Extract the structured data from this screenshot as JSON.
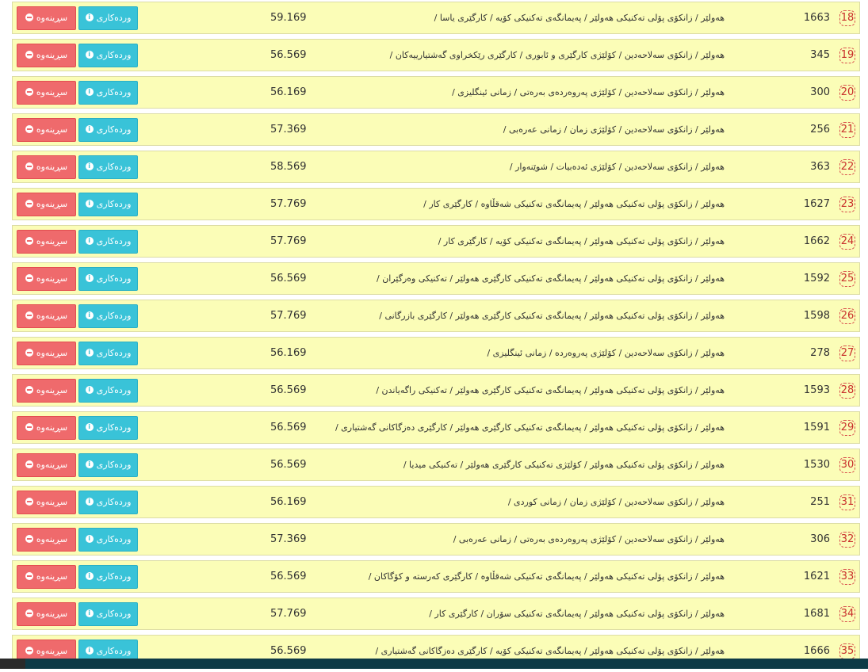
{
  "buttons": {
    "delete_label": "سڕینەوە",
    "info_label": "وردەکاری"
  },
  "rows": [
    {
      "rank": "18",
      "code": "1663",
      "path": "هەولێر / زانکۆی پۆلی تەکنیکی هەولێر / پەیمانگەی تەکنیکی کۆیە / کارگێری یاسا /",
      "score": "59.169"
    },
    {
      "rank": "19",
      "code": "345",
      "path": "هەولێر / زانکۆی سەلاحەدین / کۆلێژی کارگێری و ئابوری / کارگێری رێکخراوی گەشتیارییەکان /",
      "score": "56.569"
    },
    {
      "rank": "20",
      "code": "300",
      "path": "هەولێر / زانکۆی سەلاحەدین / کۆلێژی پەروەردەی بەرەتی / زمانی ئینگلیزی /",
      "score": "56.169"
    },
    {
      "rank": "21",
      "code": "256",
      "path": "هەولێر / زانکۆی سەلاحەدین / کۆلێژی زمان / زمانی عەرەبی /",
      "score": "57.369"
    },
    {
      "rank": "22",
      "code": "363",
      "path": "هەولێر / زانکۆی سەلاحەدین / کۆلێژی ئەدەبیات / شوێنەوار /",
      "score": "58.569"
    },
    {
      "rank": "23",
      "code": "1627",
      "path": "هەولێر / زانکۆی پۆلی تەکنیکی هەولێر / پەیمانگەی تەکنیکی شەقڵاوە / کارگێری کار /",
      "score": "57.769"
    },
    {
      "rank": "24",
      "code": "1662",
      "path": "هەولێر / زانکۆی پۆلی تەکنیکی هەولێر / پەیمانگەی تەکنیکی کۆیە / کارگێری کار /",
      "score": "57.769"
    },
    {
      "rank": "25",
      "code": "1592",
      "path": "هەولێر / زانکۆی پۆلی تەکنیکی هەولێر / پەیمانگەی تەکنیکی کارگێری هەولێر / تەکنیکی وەرگێران /",
      "score": "56.569"
    },
    {
      "rank": "26",
      "code": "1598",
      "path": "هەولێر / زانکۆی پۆلی تەکنیکی هەولێر / پەیمانگەی تەکنیکی کارگێری هەولێر / کارگێری بازرگانی /",
      "score": "57.769"
    },
    {
      "rank": "27",
      "code": "278",
      "path": "هەولێر / زانکۆی سەلاحەدین / کۆلێژی پەروەردە / زمانی ئینگلیزی /",
      "score": "56.169"
    },
    {
      "rank": "28",
      "code": "1593",
      "path": "هەولێر / زانکۆی پۆلی تەکنیکی هەولێر / پەیمانگەی تەکنیکی کارگێری هەولێر / تەکنیکی راگەیاندن /",
      "score": "56.569"
    },
    {
      "rank": "29",
      "code": "1591",
      "path": "هەولێر / زانکۆی پۆلی تەکنیکی هەولێر / پەیمانگەی تەکنیکی کارگێری هەولێر / کارگێری دەزگاکانی گەشتیاری /",
      "score": "56.569"
    },
    {
      "rank": "30",
      "code": "1530",
      "path": "هەولێر / زانکۆی پۆلی تەکنیکی هەولێر / کۆلێژی تەکنیکی کارگێری هەولێر / تەکنیکی میدیا /",
      "score": "56.569"
    },
    {
      "rank": "31",
      "code": "251",
      "path": "هەولێر / زانکۆی سەلاحەدین / کۆلێژی زمان / زمانی کوردی /",
      "score": "56.169"
    },
    {
      "rank": "32",
      "code": "306",
      "path": "هەولێر / زانکۆی سەلاحەدین / کۆلێژی پەروەردەی بەرەتی / زمانی عەرەبی /",
      "score": "57.369"
    },
    {
      "rank": "33",
      "code": "1621",
      "path": "هەولێر / زانکۆی پۆلی تەکنیکی هەولێر / پەیمانگەی تەکنیکی شەقڵاوە / کارگێری کەرستە و کۆگاکان /",
      "score": "56.569"
    },
    {
      "rank": "34",
      "code": "1681",
      "path": "هەولێر / زانکۆی پۆلی تەکنیکی هەولێر / پەیمانگەی تەکنیکی سۆران / کارگێری کار /",
      "score": "57.769"
    },
    {
      "rank": "35",
      "code": "1666",
      "path": "هەولێر / زانکۆی پۆلی تەکنیکی هەولێر / پەیمانگەی تەکنیکی کۆیە / کارگێری دەزگاکانی گەشتیاری /",
      "score": "56.569"
    }
  ]
}
